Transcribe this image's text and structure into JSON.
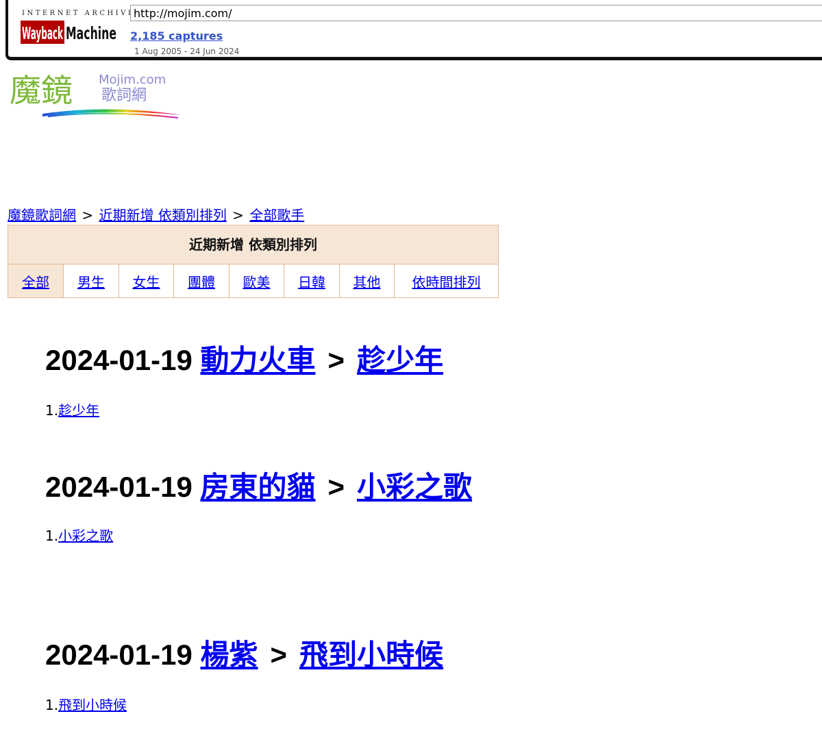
{
  "wayback": {
    "logo_top": "INTERNET ARCHIVE",
    "logo_main": "WaybackMachine",
    "url": "http://mojim.com/",
    "captures": "2,185 captures",
    "range": "1 Aug 2005 - 24 Jun 2024"
  },
  "site_logo": {
    "chinese": "魔鏡",
    "domain": "Mojim.com",
    "subtitle": "歌詞網"
  },
  "breadcrumb": {
    "home": "魔鏡歌詞網",
    "section": "近期新增 依類別排列",
    "current": "全部歌手",
    "separator": ">"
  },
  "category_table": {
    "title": "近期新增 依類別排列",
    "tabs": [
      "全部",
      "男生",
      "女生",
      "團體",
      "歐美",
      "日韓",
      "其他",
      "依時間排列"
    ],
    "selected": "全部"
  },
  "entries": [
    {
      "date": "2024-01-19",
      "artist": "動力火車",
      "separator": ">",
      "album": "趁少年",
      "songs": [
        {
          "num": "1.",
          "title": "趁少年"
        }
      ]
    },
    {
      "date": "2024-01-19",
      "artist": "房東的貓",
      "separator": ">",
      "album": "小彩之歌",
      "songs": [
        {
          "num": "1.",
          "title": "小彩之歌"
        }
      ]
    },
    {
      "date": "2024-01-19",
      "artist": "楊紫",
      "separator": ">",
      "album": "飛到小時候",
      "songs": [
        {
          "num": "1.",
          "title": "飛到小時候"
        }
      ]
    }
  ],
  "colors": {
    "link": "#0000ee",
    "table_border": "#e3b890",
    "table_header_bg": "#f6e6d6"
  }
}
